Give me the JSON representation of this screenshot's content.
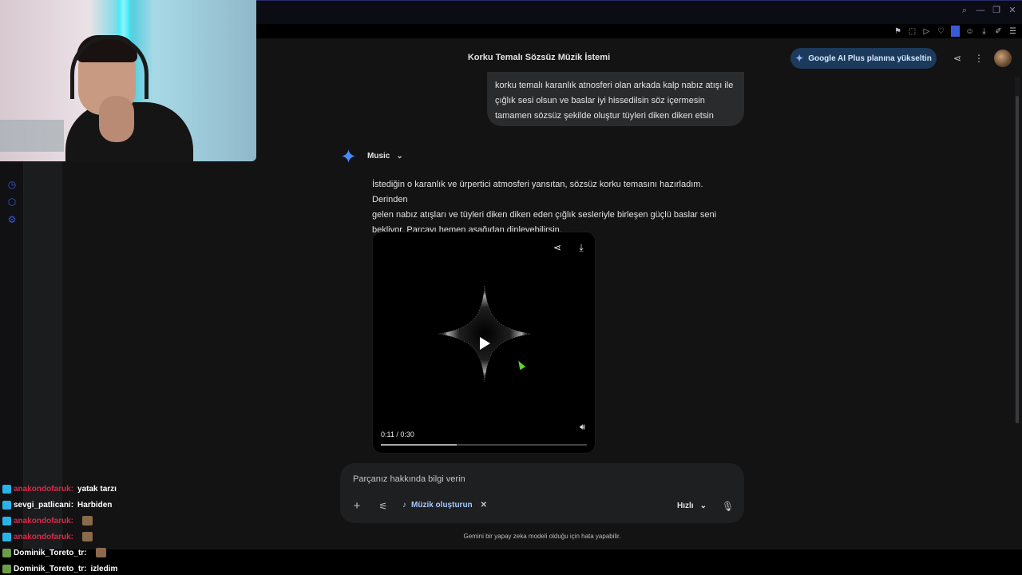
{
  "window": {
    "controls": [
      "search-icon",
      "minimize-icon",
      "restore-icon",
      "close-icon"
    ]
  },
  "header": {
    "title": "Korku Temalı Sözsüz Müzik İstemi",
    "upgrade_label": "Google AI Plus planına yükseltin",
    "accent_color": "#1b3a5c"
  },
  "conversation": {
    "user_message_lines": [
      "korku temalı karanlık atnosferi olan arkada kalp nabız atışı ile",
      "çığlık sesi olsun ve baslar iyi hissedilsin söz içermesin",
      "tamamen sözsüz şekilde oluştur tüyleri diken diken etsin"
    ],
    "model_label": "Music",
    "response_lines": [
      "İstediğin o karanlık ve ürpertici atmosferi yansıtan, sözsüz korku temasını hazırladım. Derinden",
      "gelen nabız atışları ve tüyleri diken diken eden çığlık sesleriyle birleşen güçlü baslar seni",
      "bekliyor. Parçayı hemen aşağıdan dinleyebilirsin."
    ]
  },
  "player": {
    "time": "0:11 / 0:30",
    "progress": 0.3667
  },
  "composer": {
    "placeholder": "Parçanız hakkında bilgi verin",
    "chip_label": "Müzik oluşturun",
    "speed_label": "Hızlı"
  },
  "disclaimer": "Gemini bir yapay zeka modeli olduğu için hata yapabilir.",
  "chat": [
    {
      "user": "anakondofaruk:",
      "message": "yatak tarzı",
      "color": "#d92a4a",
      "emote": false
    },
    {
      "user": "sevgi_patlicani:",
      "message": "Harbiden",
      "color": "#ffffff",
      "emote": false
    },
    {
      "user": "anakondofaruk:",
      "message": "",
      "color": "#d92a4a",
      "emote": true
    },
    {
      "user": "anakondofaruk:",
      "message": "",
      "color": "#d92a4a",
      "emote": true
    },
    {
      "user": "Dominik_Toreto_tr:",
      "message": "",
      "color": "#ffffff",
      "emote": true
    },
    {
      "user": "Dominik_Toreto_tr:",
      "message": "izledim",
      "color": "#ffffff",
      "emote": false
    }
  ]
}
